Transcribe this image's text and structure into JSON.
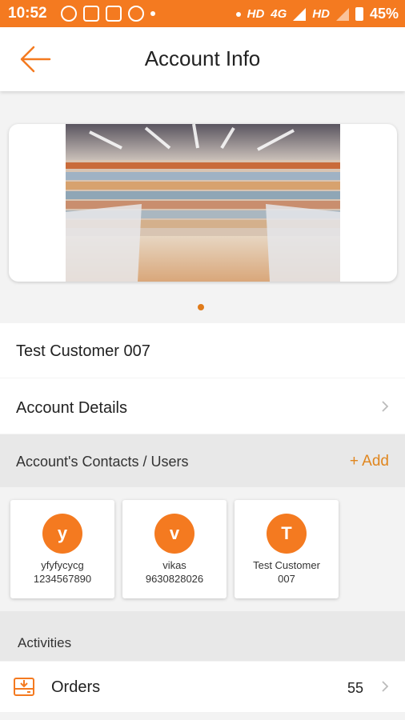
{
  "status_bar": {
    "time": "10:52",
    "network_left": "HD",
    "network_type": "4G",
    "network_right": "HD",
    "battery": "45%"
  },
  "app_bar": {
    "title": "Account Info",
    "back_icon": "arrow-left-icon"
  },
  "banner": {
    "image": "supermarket aisle photo",
    "page_indicator": {
      "current": 1,
      "total": 1
    }
  },
  "customer": {
    "name": "Test Customer 007"
  },
  "account_details": {
    "label": "Account Details"
  },
  "contacts": {
    "header": "Account's Contacts / Users",
    "add_label": "+ Add",
    "items": [
      {
        "initial": "y",
        "name": "yfyfycycg",
        "phone": "1234567890"
      },
      {
        "initial": "v",
        "name": "vikas",
        "phone": "9630828026"
      },
      {
        "initial": "T",
        "name": "Test Customer 007",
        "phone": ""
      }
    ]
  },
  "activities": {
    "header": "Activities",
    "items": [
      {
        "label": "Orders",
        "count": "55",
        "icon": "download-tray-icon"
      }
    ]
  },
  "colors": {
    "accent": "#f47a20",
    "accent_text": "#e0861e",
    "section_bg": "#e8e8e8"
  }
}
